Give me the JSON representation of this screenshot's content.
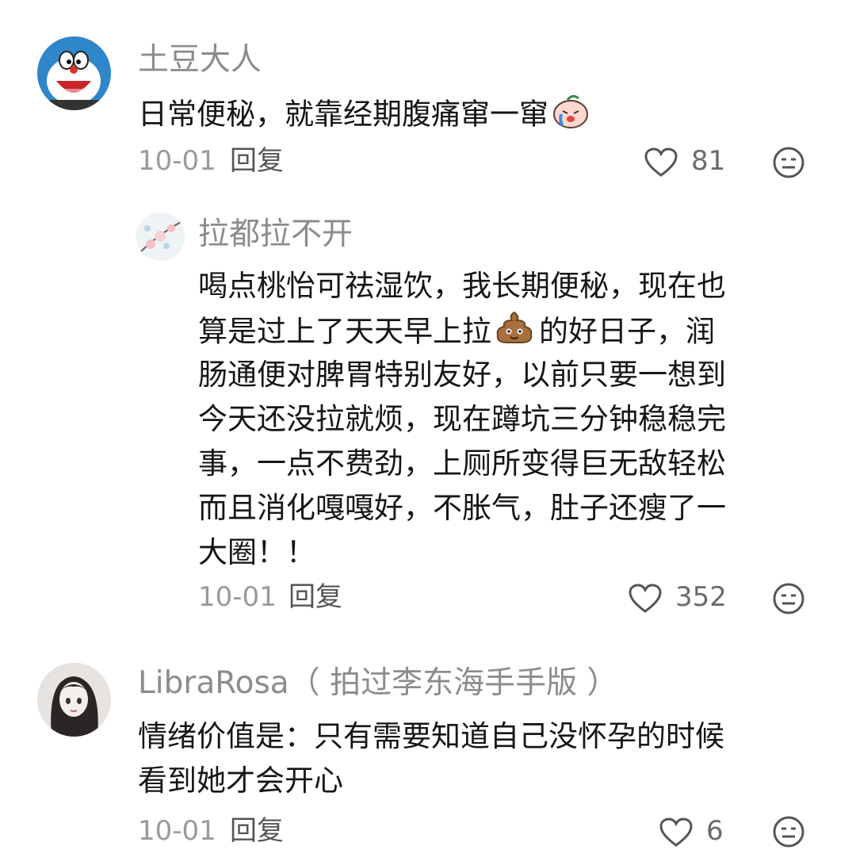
{
  "comments": [
    {
      "username": "土豆大人",
      "lines": [
        "日常便秘，就靠经期腹痛窜一窜"
      ],
      "date": "10-01",
      "reply_label": "回复",
      "likes": "81",
      "avatar_icon": "doraemon-avatar",
      "emoji_icon": "crying-peach-emoji"
    },
    {
      "username": "拉都拉不开",
      "lines": [
        "喝点桃怡可祛湿饮，我长期便秘，现在也",
        "算是过上了天天早上拉",
        "的好日子，润",
        "肠通便对脾胃特别友好，以前只要一想到",
        "今天还没拉就烦，现在蹲坑三分钟稳稳完",
        "事，一点不费劲，上厕所变得巨无敌轻松",
        "而且消化嘎嘎好，不胀气，肚子还瘦了一",
        "大圈！！"
      ],
      "date": "10-01",
      "reply_label": "回复",
      "likes": "352",
      "avatar_icon": "blossom-avatar",
      "emoji_icon": "poop-emoji"
    },
    {
      "username": "LibraRosa（ 拍过李东海手手版 ）",
      "lines": [
        "情绪价值是：只有需要知道自己没怀孕的时候",
        "看到她才会开心"
      ],
      "date": "10-01",
      "reply_label": "回复",
      "likes": "6",
      "avatar_icon": "anime-girl-avatar"
    }
  ],
  "colors": {
    "username": "#8c8c8c",
    "text": "#161616",
    "meta": "#9a9a9a",
    "icon": "#555555"
  }
}
